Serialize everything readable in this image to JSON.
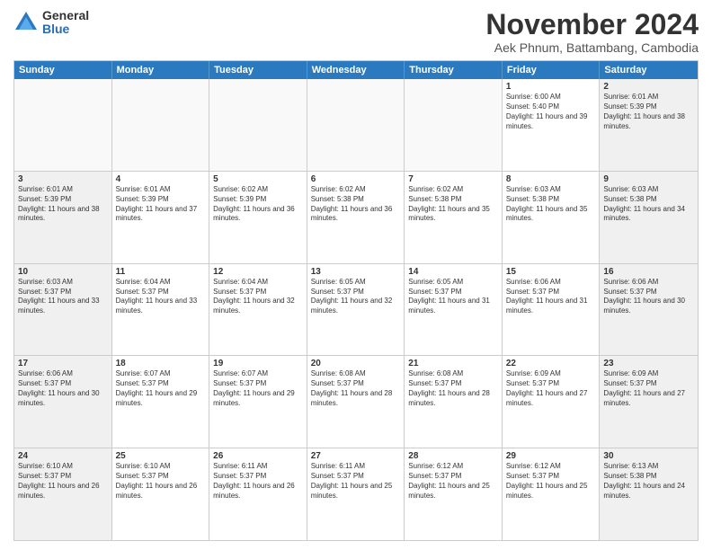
{
  "header": {
    "logo": {
      "general": "General",
      "blue": "Blue"
    },
    "title": "November 2024",
    "location": "Aek Phnum, Battambang, Cambodia"
  },
  "weekdays": [
    "Sunday",
    "Monday",
    "Tuesday",
    "Wednesday",
    "Thursday",
    "Friday",
    "Saturday"
  ],
  "weeks": [
    [
      {
        "day": "",
        "empty": true
      },
      {
        "day": "",
        "empty": true
      },
      {
        "day": "",
        "empty": true
      },
      {
        "day": "",
        "empty": true
      },
      {
        "day": "",
        "empty": true
      },
      {
        "day": "1",
        "sunrise": "6:00 AM",
        "sunset": "5:40 PM",
        "daylight": "11 hours and 39 minutes."
      },
      {
        "day": "2",
        "sunrise": "6:01 AM",
        "sunset": "5:39 PM",
        "daylight": "11 hours and 38 minutes."
      }
    ],
    [
      {
        "day": "3",
        "sunrise": "6:01 AM",
        "sunset": "5:39 PM",
        "daylight": "11 hours and 38 minutes."
      },
      {
        "day": "4",
        "sunrise": "6:01 AM",
        "sunset": "5:39 PM",
        "daylight": "11 hours and 37 minutes."
      },
      {
        "day": "5",
        "sunrise": "6:02 AM",
        "sunset": "5:39 PM",
        "daylight": "11 hours and 36 minutes."
      },
      {
        "day": "6",
        "sunrise": "6:02 AM",
        "sunset": "5:38 PM",
        "daylight": "11 hours and 36 minutes."
      },
      {
        "day": "7",
        "sunrise": "6:02 AM",
        "sunset": "5:38 PM",
        "daylight": "11 hours and 35 minutes."
      },
      {
        "day": "8",
        "sunrise": "6:03 AM",
        "sunset": "5:38 PM",
        "daylight": "11 hours and 35 minutes."
      },
      {
        "day": "9",
        "sunrise": "6:03 AM",
        "sunset": "5:38 PM",
        "daylight": "11 hours and 34 minutes."
      }
    ],
    [
      {
        "day": "10",
        "sunrise": "6:03 AM",
        "sunset": "5:37 PM",
        "daylight": "11 hours and 33 minutes."
      },
      {
        "day": "11",
        "sunrise": "6:04 AM",
        "sunset": "5:37 PM",
        "daylight": "11 hours and 33 minutes."
      },
      {
        "day": "12",
        "sunrise": "6:04 AM",
        "sunset": "5:37 PM",
        "daylight": "11 hours and 32 minutes."
      },
      {
        "day": "13",
        "sunrise": "6:05 AM",
        "sunset": "5:37 PM",
        "daylight": "11 hours and 32 minutes."
      },
      {
        "day": "14",
        "sunrise": "6:05 AM",
        "sunset": "5:37 PM",
        "daylight": "11 hours and 31 minutes."
      },
      {
        "day": "15",
        "sunrise": "6:06 AM",
        "sunset": "5:37 PM",
        "daylight": "11 hours and 31 minutes."
      },
      {
        "day": "16",
        "sunrise": "6:06 AM",
        "sunset": "5:37 PM",
        "daylight": "11 hours and 30 minutes."
      }
    ],
    [
      {
        "day": "17",
        "sunrise": "6:06 AM",
        "sunset": "5:37 PM",
        "daylight": "11 hours and 30 minutes."
      },
      {
        "day": "18",
        "sunrise": "6:07 AM",
        "sunset": "5:37 PM",
        "daylight": "11 hours and 29 minutes."
      },
      {
        "day": "19",
        "sunrise": "6:07 AM",
        "sunset": "5:37 PM",
        "daylight": "11 hours and 29 minutes."
      },
      {
        "day": "20",
        "sunrise": "6:08 AM",
        "sunset": "5:37 PM",
        "daylight": "11 hours and 28 minutes."
      },
      {
        "day": "21",
        "sunrise": "6:08 AM",
        "sunset": "5:37 PM",
        "daylight": "11 hours and 28 minutes."
      },
      {
        "day": "22",
        "sunrise": "6:09 AM",
        "sunset": "5:37 PM",
        "daylight": "11 hours and 27 minutes."
      },
      {
        "day": "23",
        "sunrise": "6:09 AM",
        "sunset": "5:37 PM",
        "daylight": "11 hours and 27 minutes."
      }
    ],
    [
      {
        "day": "24",
        "sunrise": "6:10 AM",
        "sunset": "5:37 PM",
        "daylight": "11 hours and 26 minutes."
      },
      {
        "day": "25",
        "sunrise": "6:10 AM",
        "sunset": "5:37 PM",
        "daylight": "11 hours and 26 minutes."
      },
      {
        "day": "26",
        "sunrise": "6:11 AM",
        "sunset": "5:37 PM",
        "daylight": "11 hours and 26 minutes."
      },
      {
        "day": "27",
        "sunrise": "6:11 AM",
        "sunset": "5:37 PM",
        "daylight": "11 hours and 25 minutes."
      },
      {
        "day": "28",
        "sunrise": "6:12 AM",
        "sunset": "5:37 PM",
        "daylight": "11 hours and 25 minutes."
      },
      {
        "day": "29",
        "sunrise": "6:12 AM",
        "sunset": "5:37 PM",
        "daylight": "11 hours and 25 minutes."
      },
      {
        "day": "30",
        "sunrise": "6:13 AM",
        "sunset": "5:38 PM",
        "daylight": "11 hours and 24 minutes."
      }
    ]
  ]
}
